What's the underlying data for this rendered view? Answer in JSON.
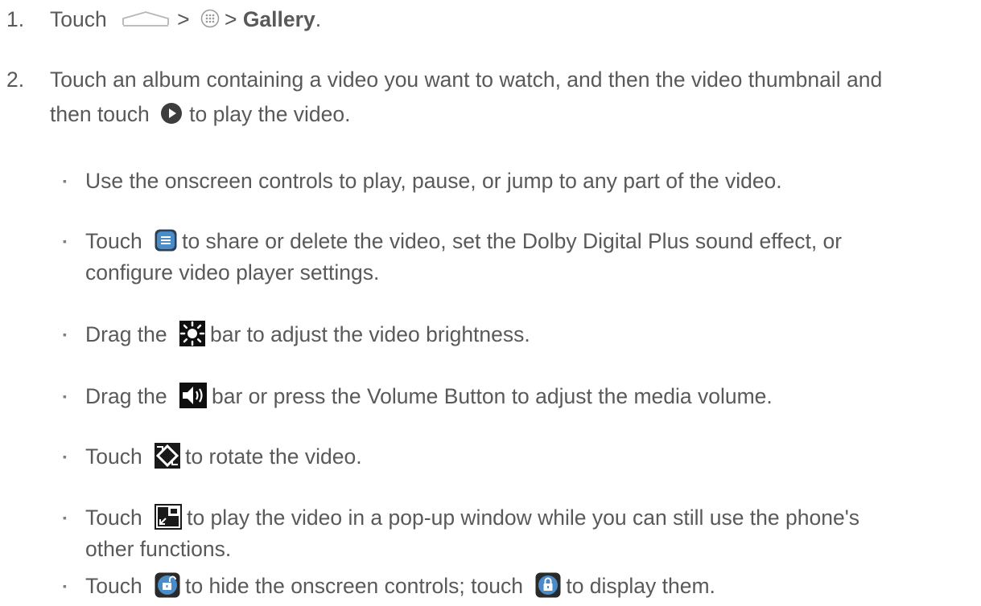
{
  "steps": [
    {
      "number": "1.",
      "pre": "Touch",
      "sep1": ">",
      "sep2": ">",
      "bold": "Gallery",
      "end": ".",
      "icons": [
        "home-icon",
        "apps-icon"
      ]
    },
    {
      "number": "2.",
      "line1": "Touch an album containing a video you want to watch, and then the video thumbnail and",
      "line2_pre": "then touch",
      "line2_post": "to play the video.",
      "icons": [
        "play-icon"
      ]
    }
  ],
  "bullets": [
    {
      "marker": "▪",
      "text": "Use the onscreen controls to play, pause, or jump to any part of the video."
    },
    {
      "marker": "▪",
      "pre": "Touch",
      "post": "to share or delete the video, set the Dolby Digital Plus sound effect, or",
      "line2": "configure video player settings.",
      "icon": "menu-icon"
    },
    {
      "marker": "▪",
      "pre": "Drag the",
      "post": "bar to adjust the video brightness.",
      "icon": "brightness-icon"
    },
    {
      "marker": "▪",
      "pre": "Drag the",
      "post": "bar or press the Volume Button to adjust the media volume.",
      "icon": "volume-icon"
    },
    {
      "marker": "▪",
      "pre": "Touch",
      "post": "to rotate the video.",
      "icon": "rotate-icon"
    },
    {
      "marker": "▪",
      "pre": "Touch",
      "post": "to play the video in a pop-up window while you can still use the phone's",
      "line2": "other functions.",
      "icon": "popup-window-icon"
    },
    {
      "marker": "▪",
      "pre": "Touch",
      "mid": "to hide the onscreen controls; touch",
      "post": "to display them.",
      "icons": [
        "unlock-icon",
        "lock-icon"
      ]
    }
  ]
}
